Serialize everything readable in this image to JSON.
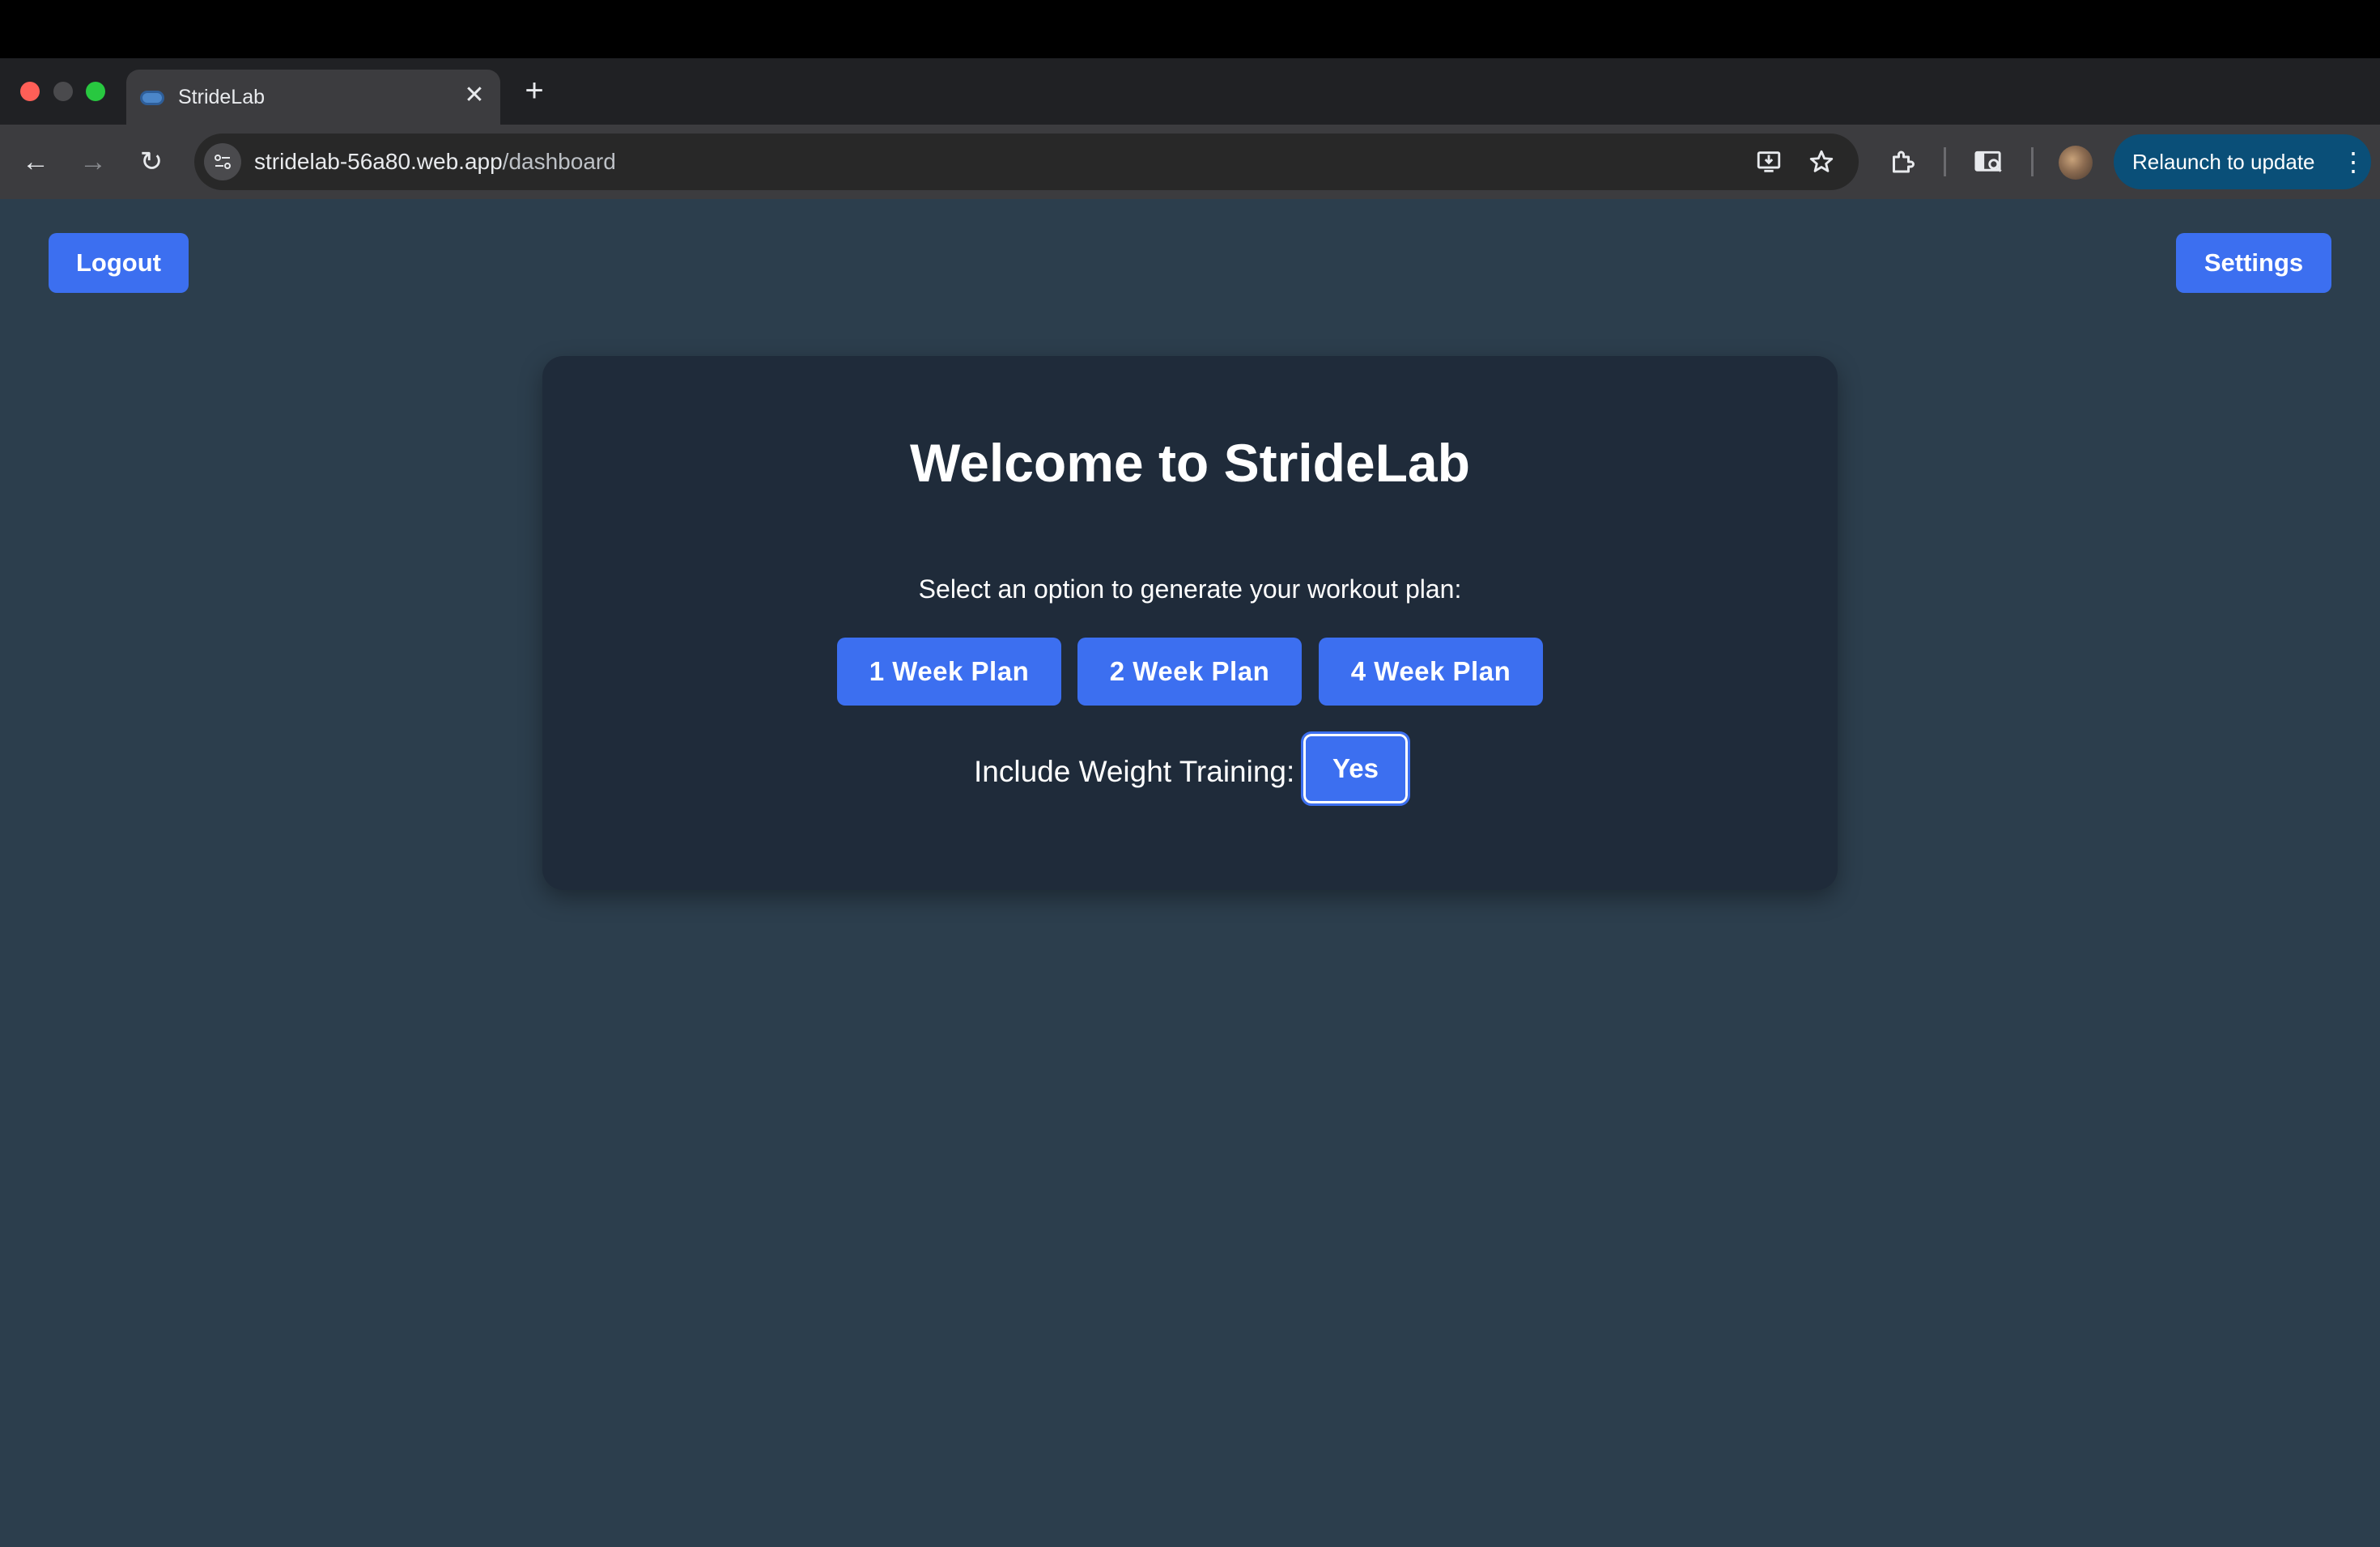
{
  "browser": {
    "tab": {
      "title": "StrideLab",
      "close_glyph": "✕"
    },
    "new_tab_glyph": "+",
    "nav": {
      "back_glyph": "←",
      "forward_glyph": "→",
      "reload_glyph": "↻"
    },
    "url": {
      "host": "stridelab-56a80.web.app",
      "path": "/dashboard"
    },
    "toolbar_icons": [
      "install-app-icon",
      "bookmark-star-icon",
      "extensions-icon",
      "cast-search-icon",
      "profile-avatar"
    ],
    "relaunch": {
      "label": "Relaunch to update",
      "menu_glyph": "⋮"
    }
  },
  "header": {
    "logout_label": "Logout",
    "settings_label": "Settings"
  },
  "card": {
    "title": "Welcome to StrideLab",
    "subtitle": "Select an option to generate your workout plan:",
    "plans": [
      {
        "label": "1 Week Plan"
      },
      {
        "label": "2 Week Plan"
      },
      {
        "label": "4 Week Plan"
      }
    ],
    "weight_training": {
      "label": "Include Weight Training:",
      "value": "Yes"
    }
  },
  "colors": {
    "page_background": "#2c3e4d",
    "card_background": "#1f2b3a",
    "button_primary": "#3c6ff0",
    "relaunch_background": "#0a4f78"
  }
}
